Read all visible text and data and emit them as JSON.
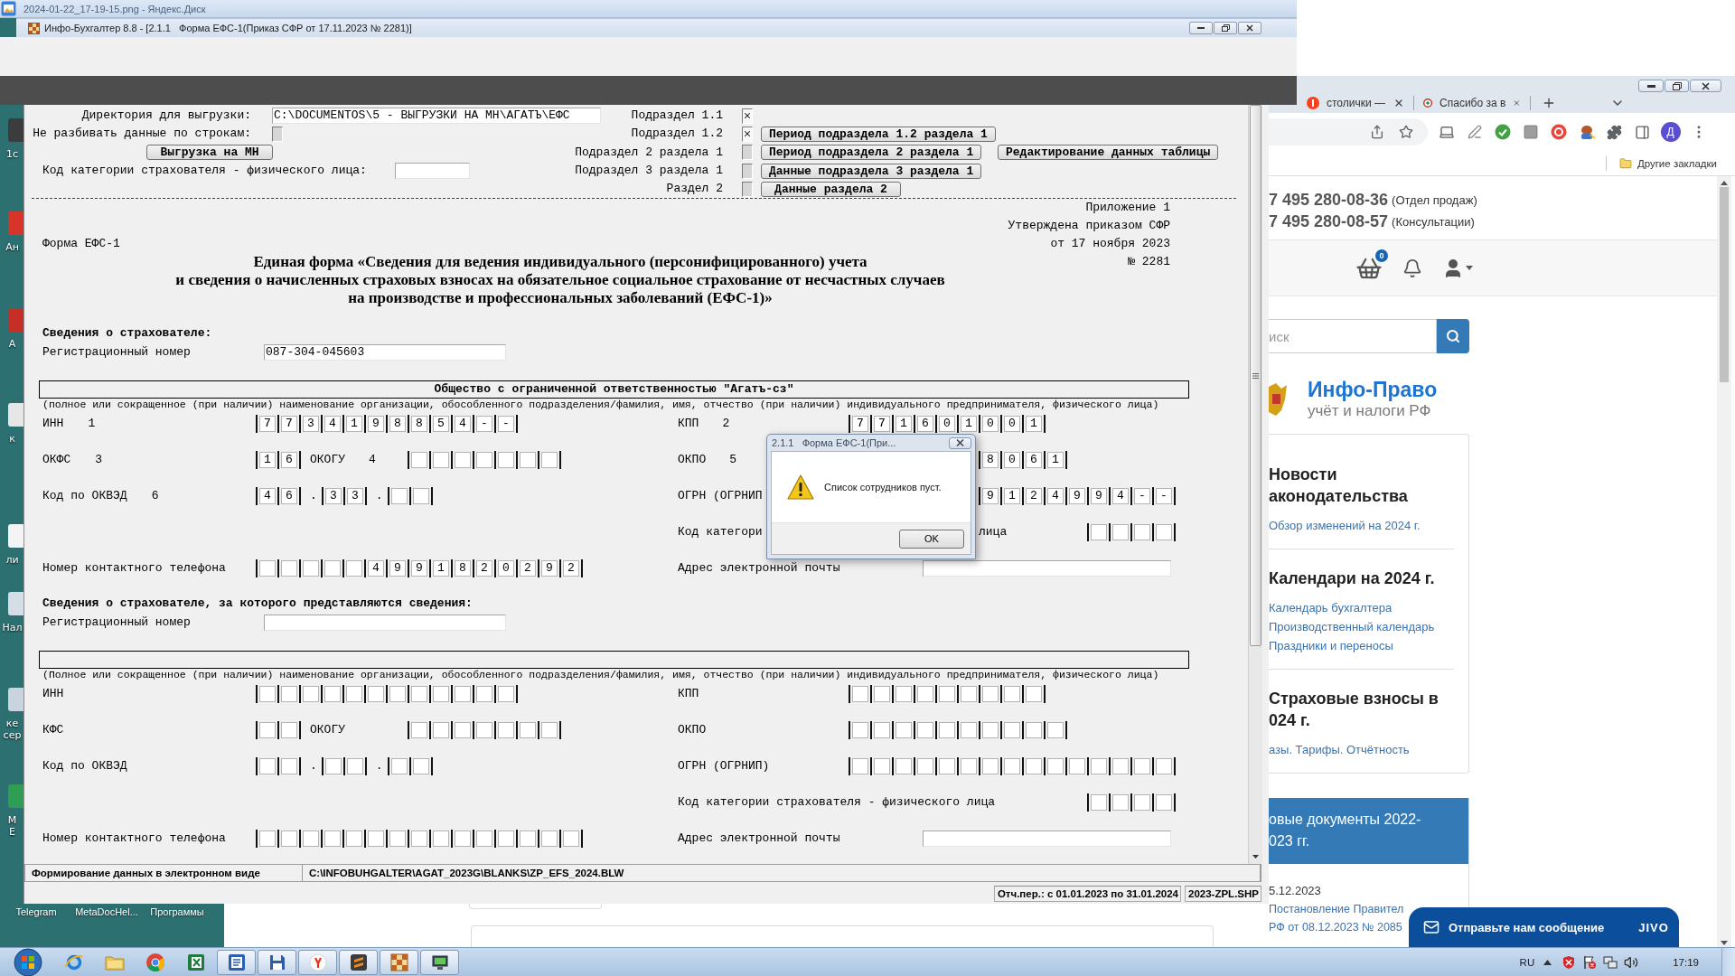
{
  "image_viewer": {
    "title": "2024-01-22_17-19-15.png - Яндекс.Диск"
  },
  "desktop": {
    "side_icons": [
      {
        "lines": [
          "1с"
        ]
      },
      {
        "lines": [
          "Ан"
        ]
      },
      {
        "lines": [
          "А"
        ]
      },
      {
        "lines": [
          "к"
        ]
      },
      {
        "lines": [
          "ли"
        ]
      },
      {
        "lines": [
          "Нал"
        ]
      },
      {
        "lines": [
          "ке",
          "сер"
        ]
      },
      {
        "lines": [
          "М",
          "Е"
        ]
      }
    ],
    "bottom_labels": [
      "Telegram",
      "MetaDocHel...",
      "Программы"
    ]
  },
  "app": {
    "title": "Инфо-Бухгалтер 8.8 - [2.1.1   Форма ЕФС-1(Приказ СФР от 17.11.2023 № 2281)]",
    "export": {
      "directory": {
        "label": "Директория для выгрузки:",
        "value": "C:\\DOCUMENTOS\\5 - ВЫГРУЗКИ НА МН\\АГАТЪ\\ЕФС"
      },
      "no_split": {
        "label": "Не разбивать данные по строкам:",
        "checked": false
      },
      "export_button": "Выгрузка на МН",
      "category_label": "Код категории страхователя - физического лица:",
      "sections": [
        {
          "label": "Подраздел 1.1",
          "checked": true
        },
        {
          "label": "Подраздел 1.2",
          "checked": true,
          "buttons": [
            "Период подраздела 1.2 раздела 1"
          ]
        },
        {
          "label": "Подраздел 2 раздела 1",
          "checked": false,
          "buttons": [
            "Период подраздела 2 раздела 1",
            "Редактирование данных таблицы"
          ]
        },
        {
          "label": "Подраздел 3 раздела 1",
          "checked": false,
          "buttons": [
            "Данные подраздела 3 раздела 1"
          ]
        },
        {
          "label": "Раздел 2",
          "checked": false,
          "buttons": [
            "Данные раздела 2"
          ]
        }
      ]
    },
    "form": {
      "appendix": [
        "Приложение 1",
        "Утверждена приказом СФР",
        "от 17 ноября 2023",
        "№ 2281"
      ],
      "code": "Форма ЕФС-1",
      "title": [
        "Единая форма «Сведения для ведения индивидуального (персонифицированного) учета",
        "и сведения о начисленных страховых взносах на обязательное социальное страхование от несчастных случаев",
        "на производстве и профессиональных заболеваний (ЕФС-1)»"
      ],
      "sections": [
        {
          "heading": "Сведения о страхователе:",
          "reg_label": "Регистрационный номер",
          "reg_value": "087-304-045603",
          "org_name": "Общество с ограниченной ответственностью \"Агатъ-сз\"",
          "caption": "(полное или сокращенное (при наличии) наименование организации, обособленного подразделения/фамилия, имя, отчество (при наличии) индивидуального предпринимателя, физического лица)",
          "rows": [
            {
              "left": {
                "label": "ИНН",
                "code": "1",
                "parts": [
                  {
                    "kind": "cells",
                    "cells": [
                      {
                        "kind": "char",
                        "text": "7"
                      },
                      {
                        "kind": "char",
                        "text": "7"
                      },
                      {
                        "kind": "char",
                        "text": "3"
                      },
                      {
                        "kind": "char",
                        "text": "4"
                      },
                      {
                        "kind": "char",
                        "text": "1"
                      },
                      {
                        "kind": "char",
                        "text": "9"
                      },
                      {
                        "kind": "char",
                        "text": "8"
                      },
                      {
                        "kind": "char",
                        "text": "8"
                      },
                      {
                        "kind": "char",
                        "text": "5"
                      },
                      {
                        "kind": "char",
                        "text": "4"
                      },
                      {
                        "kind": "char",
                        "text": "-"
                      },
                      {
                        "kind": "char",
                        "text": "-"
                      }
                    ]
                  }
                ]
              },
              "right": {
                "label": "КПП",
                "code": "2",
                "parts": [
                  {
                    "kind": "cells",
                    "cells": [
                      {
                        "kind": "char",
                        "text": "7"
                      },
                      {
                        "kind": "char",
                        "text": "7"
                      },
                      {
                        "kind": "char",
                        "text": "1"
                      },
                      {
                        "kind": "char",
                        "text": "6"
                      },
                      {
                        "kind": "char",
                        "text": "0"
                      },
                      {
                        "kind": "char",
                        "text": "1"
                      },
                      {
                        "kind": "char",
                        "text": "0"
                      },
                      {
                        "kind": "char",
                        "text": "0"
                      },
                      {
                        "kind": "char",
                        "text": "1"
                      }
                    ]
                  }
                ]
              }
            },
            {
              "left": {
                "label": "ОКФС",
                "code": "3",
                "parts": [
                  {
                    "kind": "cells",
                    "cells": [
                      {
                        "kind": "char",
                        "text": "1"
                      },
                      {
                        "kind": "char",
                        "text": "6"
                      }
                    ]
                  },
                  {
                    "kind": "label",
                    "text": "ОКОГУ"
                  },
                  {
                    "kind": "code",
                    "text": "4"
                  },
                  {
                    "kind": "cells",
                    "cells": [
                      {
                        "kind": "blank"
                      },
                      {
                        "kind": "blank"
                      },
                      {
                        "kind": "blank"
                      },
                      {
                        "kind": "blank"
                      },
                      {
                        "kind": "blank"
                      },
                      {
                        "kind": "blank"
                      },
                      {
                        "kind": "blank"
                      }
                    ]
                  }
                ]
              },
              "right": {
                "label": "ОКПО",
                "code": "5",
                "parts": [
                  {
                    "kind": "cells",
                    "cells": [
                      {
                        "kind": "char",
                        "text": "8"
                      },
                      {
                        "kind": "char",
                        "text": "0"
                      },
                      {
                        "kind": "char",
                        "text": "6"
                      },
                      {
                        "kind": "char",
                        "text": "1"
                      }
                    ]
                  }
                ]
              }
            },
            {
              "left": {
                "label": "Код по ОКВЭД",
                "code": "6",
                "parts": [
                  {
                    "kind": "cells",
                    "cells": [
                      {
                        "kind": "char",
                        "text": "4"
                      },
                      {
                        "kind": "char",
                        "text": "6"
                      }
                    ]
                  },
                  {
                    "kind": "dot",
                    "text": "."
                  },
                  {
                    "kind": "cells",
                    "cells": [
                      {
                        "kind": "char",
                        "text": "3"
                      },
                      {
                        "kind": "char",
                        "text": "3"
                      }
                    ]
                  },
                  {
                    "kind": "dot",
                    "text": "."
                  },
                  {
                    "kind": "cells",
                    "cells": [
                      {
                        "kind": "blank"
                      },
                      {
                        "kind": "blank"
                      }
                    ]
                  }
                ]
              },
              "right": {
                "label": "ОГРН (ОГРНИП",
                "parts": [
                  {
                    "kind": "cells",
                    "cells": [
                      {
                        "kind": "char",
                        "text": "9"
                      },
                      {
                        "kind": "char",
                        "text": "1"
                      },
                      {
                        "kind": "char",
                        "text": "2"
                      },
                      {
                        "kind": "char",
                        "text": "4"
                      },
                      {
                        "kind": "char",
                        "text": "9"
                      },
                      {
                        "kind": "char",
                        "text": "9"
                      },
                      {
                        "kind": "char",
                        "text": "4"
                      },
                      {
                        "kind": "char",
                        "text": "-"
                      },
                      {
                        "kind": "char",
                        "text": "-"
                      }
                    ]
                  }
                ]
              }
            },
            {
              "right": {
                "label": "Код категори",
                "parts": [
                  {
                    "kind": "label",
                    "text": "лица"
                  },
                  {
                    "kind": "cells",
                    "cells": [
                      {
                        "kind": "blank"
                      },
                      {
                        "kind": "blank"
                      },
                      {
                        "kind": "blank"
                      },
                      {
                        "kind": "blank"
                      }
                    ]
                  }
                ]
              }
            },
            {
              "left": {
                "label": "Номер контактного телефона",
                "parts": [
                  {
                    "kind": "cells",
                    "cells": [
                      {
                        "kind": "blank"
                      },
                      {
                        "kind": "blank"
                      },
                      {
                        "kind": "blank"
                      },
                      {
                        "kind": "blank"
                      },
                      {
                        "kind": "blank"
                      },
                      {
                        "kind": "char",
                        "text": "4"
                      },
                      {
                        "kind": "char",
                        "text": "9"
                      },
                      {
                        "kind": "char",
                        "text": "9"
                      },
                      {
                        "kind": "char",
                        "text": "1"
                      },
                      {
                        "kind": "char",
                        "text": "8"
                      },
                      {
                        "kind": "char",
                        "text": "2"
                      },
                      {
                        "kind": "char",
                        "text": "0"
                      },
                      {
                        "kind": "char",
                        "text": "2"
                      },
                      {
                        "kind": "char",
                        "text": "9"
                      },
                      {
                        "kind": "char",
                        "text": "2"
                      }
                    ]
                  }
                ]
              },
              "right": {
                "label": "Адрес электронной почты",
                "parts": [
                  {
                    "kind": "input"
                  }
                ]
              }
            }
          ]
        },
        {
          "heading": "Сведения о страхователе, за которого представляются сведения:",
          "reg_label": "Регистрационный номер",
          "caption": "(Полное или сокращенное (при наличии) наименование организации, обособленного подразделения/фамилия, имя, отчество (при наличии) индивидуального предпринимателя, физического лица)",
          "rows": [
            {
              "left": {
                "label": "ИНН",
                "parts": [
                  {
                    "kind": "cells",
                    "cells": [
                      {
                        "kind": "blank"
                      },
                      {
                        "kind": "blank"
                      },
                      {
                        "kind": "blank"
                      },
                      {
                        "kind": "blank"
                      },
                      {
                        "kind": "blank"
                      },
                      {
                        "kind": "blank"
                      },
                      {
                        "kind": "blank"
                      },
                      {
                        "kind": "blank"
                      },
                      {
                        "kind": "blank"
                      },
                      {
                        "kind": "blank"
                      },
                      {
                        "kind": "blank"
                      },
                      {
                        "kind": "blank"
                      }
                    ]
                  }
                ]
              },
              "right": {
                "label": "КПП",
                "parts": [
                  {
                    "kind": "cells",
                    "cells": [
                      {
                        "kind": "blank"
                      },
                      {
                        "kind": "blank"
                      },
                      {
                        "kind": "blank"
                      },
                      {
                        "kind": "blank"
                      },
                      {
                        "kind": "blank"
                      },
                      {
                        "kind": "blank"
                      },
                      {
                        "kind": "blank"
                      },
                      {
                        "kind": "blank"
                      },
                      {
                        "kind": "blank"
                      }
                    ]
                  }
                ]
              }
            },
            {
              "left": {
                "label": "КФС",
                "parts": [
                  {
                    "kind": "cells",
                    "cells": [
                      {
                        "kind": "blank"
                      },
                      {
                        "kind": "blank"
                      }
                    ]
                  },
                  {
                    "kind": "label",
                    "text": "ОКОГУ"
                  },
                  {
                    "kind": "cells",
                    "cells": [
                      {
                        "kind": "blank"
                      },
                      {
                        "kind": "blank"
                      },
                      {
                        "kind": "blank"
                      },
                      {
                        "kind": "blank"
                      },
                      {
                        "kind": "blank"
                      },
                      {
                        "kind": "blank"
                      },
                      {
                        "kind": "blank"
                      }
                    ]
                  }
                ]
              },
              "right": {
                "label": "ОКПО",
                "parts": [
                  {
                    "kind": "cells",
                    "cells": [
                      {
                        "kind": "blank"
                      },
                      {
                        "kind": "blank"
                      },
                      {
                        "kind": "blank"
                      },
                      {
                        "kind": "blank"
                      },
                      {
                        "kind": "blank"
                      },
                      {
                        "kind": "blank"
                      },
                      {
                        "kind": "blank"
                      },
                      {
                        "kind": "blank"
                      },
                      {
                        "kind": "blank"
                      },
                      {
                        "kind": "blank"
                      }
                    ]
                  }
                ]
              }
            },
            {
              "left": {
                "label": "Код по ОКВЭД",
                "parts": [
                  {
                    "kind": "cells",
                    "cells": [
                      {
                        "kind": "blank"
                      },
                      {
                        "kind": "blank"
                      }
                    ]
                  },
                  {
                    "kind": "dot",
                    "text": "."
                  },
                  {
                    "kind": "cells",
                    "cells": [
                      {
                        "kind": "blank"
                      },
                      {
                        "kind": "blank"
                      }
                    ]
                  },
                  {
                    "kind": "dot",
                    "text": "."
                  },
                  {
                    "kind": "cells",
                    "cells": [
                      {
                        "kind": "blank"
                      },
                      {
                        "kind": "blank"
                      }
                    ]
                  }
                ]
              },
              "right": {
                "label": "ОГРН (ОГРНИП)",
                "parts": [
                  {
                    "kind": "cells",
                    "cells": [
                      {
                        "kind": "blank"
                      },
                      {
                        "kind": "blank"
                      },
                      {
                        "kind": "blank"
                      },
                      {
                        "kind": "blank"
                      },
                      {
                        "kind": "blank"
                      },
                      {
                        "kind": "blank"
                      },
                      {
                        "kind": "blank"
                      },
                      {
                        "kind": "blank"
                      },
                      {
                        "kind": "blank"
                      },
                      {
                        "kind": "blank"
                      },
                      {
                        "kind": "blank"
                      },
                      {
                        "kind": "blank"
                      },
                      {
                        "kind": "blank"
                      },
                      {
                        "kind": "blank"
                      },
                      {
                        "kind": "blank"
                      }
                    ]
                  }
                ]
              }
            },
            {
              "right": {
                "label": "Код категории страхователя - физического лица",
                "parts": [
                  {
                    "kind": "cells",
                    "cells": [
                      {
                        "kind": "blank"
                      },
                      {
                        "kind": "blank"
                      },
                      {
                        "kind": "blank"
                      },
                      {
                        "kind": "blank"
                      }
                    ]
                  }
                ]
              }
            },
            {
              "left": {
                "label": "Номер контактного телефона",
                "parts": [
                  {
                    "kind": "cells",
                    "cells": [
                      {
                        "kind": "blank"
                      },
                      {
                        "kind": "blank"
                      },
                      {
                        "kind": "blank"
                      },
                      {
                        "kind": "blank"
                      },
                      {
                        "kind": "blank"
                      },
                      {
                        "kind": "blank"
                      },
                      {
                        "kind": "blank"
                      },
                      {
                        "kind": "blank"
                      },
                      {
                        "kind": "blank"
                      },
                      {
                        "kind": "blank"
                      },
                      {
                        "kind": "blank"
                      },
                      {
                        "kind": "blank"
                      },
                      {
                        "kind": "blank"
                      },
                      {
                        "kind": "blank"
                      },
                      {
                        "kind": "blank"
                      }
                    ]
                  }
                ]
              },
              "right": {
                "label": "Адрес электронной почты",
                "parts": [
                  {
                    "kind": "input"
                  }
                ]
              }
            }
          ]
        }
      ]
    },
    "status_bar": {
      "task": "Формирование данных в электронном виде",
      "file": "C:\\INFOBUHGALTER\\AGAT_2023G\\BLANKS\\ZP_EFS_2024.BLW",
      "period": "Отч.пер.: с 01.01.2023 по 31.01.2024",
      "profile": "2023-ZPL.SHP"
    }
  },
  "dialog": {
    "title": "2.1.1   Форма ЕФС-1(При...",
    "message": "Список сотрудников пуст.",
    "button": "OK"
  },
  "browser": {
    "tabs": [
      {
        "title": "столички —",
        "selected": false
      },
      {
        "title": "Спасибо за в",
        "selected": false
      }
    ],
    "profile_initial": "Д",
    "bookmarks_folder": "Другие закладки",
    "page": {
      "phones": [
        {
          "number": "7 495 280-08-36",
          "note": "(Отдел продаж)"
        },
        {
          "number": "7 495 280-08-57",
          "note": "(Консультации)"
        }
      ],
      "cart_count": "0",
      "search_placeholder": "иск",
      "brand": {
        "name": "Инфо-Право",
        "tagline": "учёт и налоги РФ"
      },
      "sections": [
        {
          "title_lines": [
            "Новости",
            "аконодательства"
          ],
          "links": [
            "Обзор изменений на 2024 г."
          ]
        },
        {
          "title_lines": [
            "Календари на 2024 г."
          ],
          "links": [
            "Календарь бухгалтера",
            "Производственный календарь",
            "Праздники и переносы"
          ]
        },
        {
          "title_lines": [
            "Страховые взносы в",
            "024 г."
          ],
          "links": [
            "азы. Тарифы. Отчётность"
          ]
        }
      ],
      "news": {
        "title_lines": [
          "овые документы 2022-",
          "023 гг."
        ],
        "date": "5.12.2023",
        "link_lines": [
          "Постановление Правител",
          "РФ от 08.12.2023 № 2085"
        ]
      },
      "chat": {
        "label": "Отправьте нам сообщение",
        "brand": "JIVO"
      }
    }
  },
  "taskbar": {
    "apps": [
      {
        "kind": "ie",
        "running": false
      },
      {
        "kind": "folder",
        "running": false
      },
      {
        "kind": "chrome",
        "running": false
      },
      {
        "kind": "excel",
        "running": false
      },
      {
        "kind": "word",
        "running": true
      },
      {
        "kind": "floppy",
        "running": true
      },
      {
        "kind": "yandex",
        "running": true
      },
      {
        "kind": "stripes",
        "running": true
      },
      {
        "kind": "checker",
        "running": true
      },
      {
        "kind": "monitor",
        "running": true
      }
    ],
    "language": "RU",
    "time": "17:19"
  }
}
